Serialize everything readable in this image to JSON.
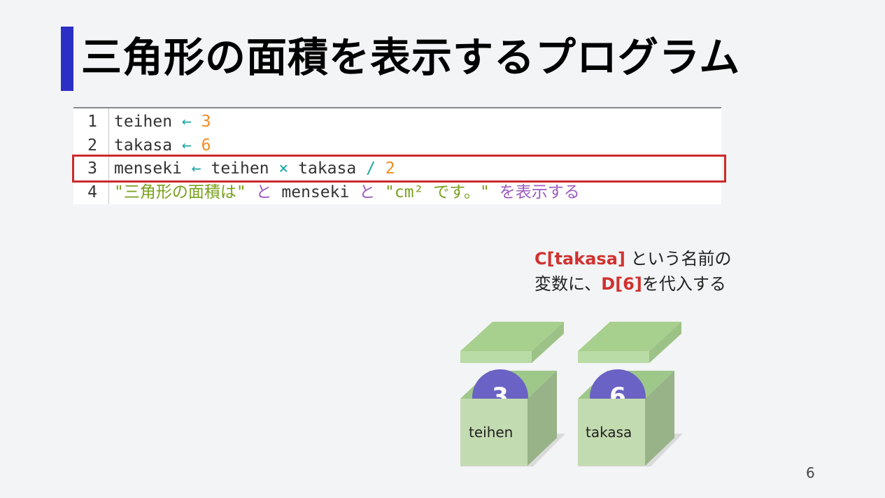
{
  "slide": {
    "title": "三角形の面積を表示するプログラム",
    "page_number": "6",
    "accent_color": "#2b2fc4"
  },
  "code": {
    "lines": [
      {
        "number": "1",
        "tokens": [
          {
            "text": "teihen ",
            "kind": "id"
          },
          {
            "text": "←",
            "kind": "op"
          },
          {
            "text": " ",
            "kind": "id"
          },
          {
            "text": "3",
            "kind": "num"
          }
        ]
      },
      {
        "number": "2",
        "tokens": [
          {
            "text": "takasa ",
            "kind": "id"
          },
          {
            "text": "←",
            "kind": "op"
          },
          {
            "text": " ",
            "kind": "id"
          },
          {
            "text": "6",
            "kind": "num"
          }
        ]
      },
      {
        "number": "3",
        "tokens": [
          {
            "text": "menseki ",
            "kind": "id"
          },
          {
            "text": "←",
            "kind": "op"
          },
          {
            "text": " teihen ",
            "kind": "id"
          },
          {
            "text": "×",
            "kind": "op"
          },
          {
            "text": " takasa ",
            "kind": "id"
          },
          {
            "text": "/",
            "kind": "op"
          },
          {
            "text": " ",
            "kind": "id"
          },
          {
            "text": "2",
            "kind": "num"
          }
        ]
      },
      {
        "number": "4",
        "tokens": [
          {
            "text": "\"三角形の面積は\"",
            "kind": "str"
          },
          {
            "text": " ",
            "kind": "id"
          },
          {
            "text": "と",
            "kind": "kw"
          },
          {
            "text": " menseki ",
            "kind": "id"
          },
          {
            "text": "と",
            "kind": "kw"
          },
          {
            "text": " ",
            "kind": "id"
          },
          {
            "text": "\"cm² です。\"",
            "kind": "str"
          },
          {
            "text": " ",
            "kind": "id"
          },
          {
            "text": "を表示する",
            "kind": "kw"
          }
        ]
      }
    ],
    "highlighted_line": "3"
  },
  "caption": {
    "var_token": "C[takasa]",
    "text1": " という名前の",
    "text2": "変数に、",
    "value_token": "D[6]",
    "text3": "を代入する"
  },
  "boxes": [
    {
      "label": "teihen",
      "value": "3"
    },
    {
      "label": "takasa",
      "value": "6"
    }
  ]
}
